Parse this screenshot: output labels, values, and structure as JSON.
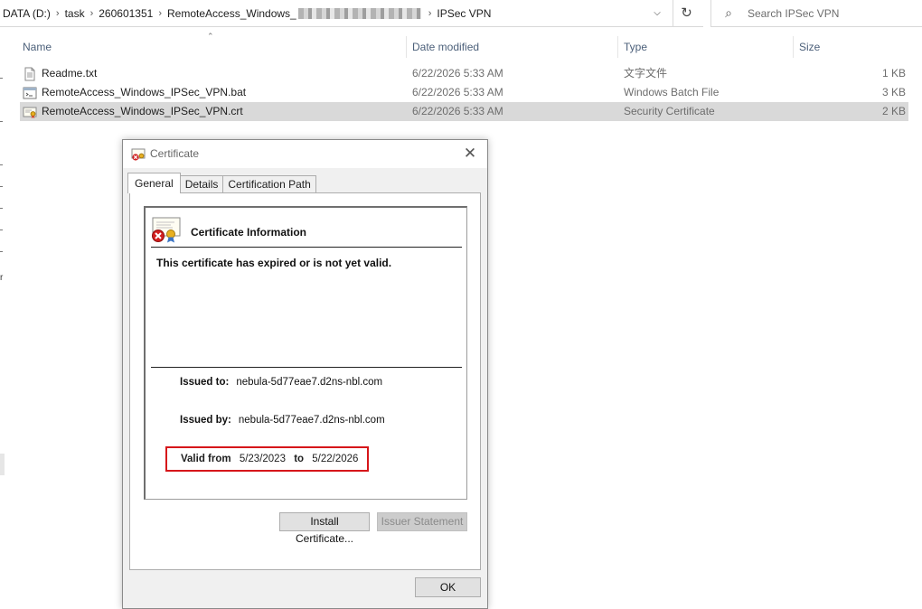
{
  "address": {
    "segments": [
      "DATA (D:)",
      "task",
      "260601351",
      "RemoteAccess_Windows_",
      "IPSec VPN"
    ],
    "separator": "›"
  },
  "search": {
    "placeholder": "Search IPSec VPN"
  },
  "columns": {
    "name": "Name",
    "date": "Date modified",
    "type": "Type",
    "size": "Size"
  },
  "files": [
    {
      "name": "Readme.txt",
      "date": "6/22/2026 5:33 AM",
      "type": "文字文件",
      "size": "1 KB",
      "icon": "text-file-icon",
      "selected": false
    },
    {
      "name": "RemoteAccess_Windows_IPSec_VPN.bat",
      "date": "6/22/2026 5:33 AM",
      "type": "Windows Batch File",
      "size": "3 KB",
      "icon": "batch-file-icon",
      "selected": false
    },
    {
      "name": "RemoteAccess_Windows_IPSec_VPN.crt",
      "date": "6/22/2026 5:33 AM",
      "type": "Security Certificate",
      "size": "2 KB",
      "icon": "certificate-file-icon",
      "selected": true
    }
  ],
  "dialog": {
    "title": "Certificate",
    "tabs": [
      "General",
      "Details",
      "Certification Path"
    ],
    "info_title": "Certificate Information",
    "message": "This certificate has expired or is not yet valid.",
    "issued_to_label": "Issued to:",
    "issued_to": "nebula-5d77eae7.d2ns-nbl.com",
    "issued_by_label": "Issued by:",
    "issued_by": "nebula-5d77eae7.d2ns-nbl.com",
    "valid_from_label": "Valid from",
    "valid_from": "5/23/2023",
    "to_label": "to",
    "valid_to": "5/22/2026",
    "install_button": "Install Certificate...",
    "issuer_button": "Issuer Statement",
    "ok_button": "OK"
  },
  "colors": {
    "highlight_box": "#d6161a",
    "selected_row": "#d9d9d9",
    "header_text": "#4c607a"
  }
}
